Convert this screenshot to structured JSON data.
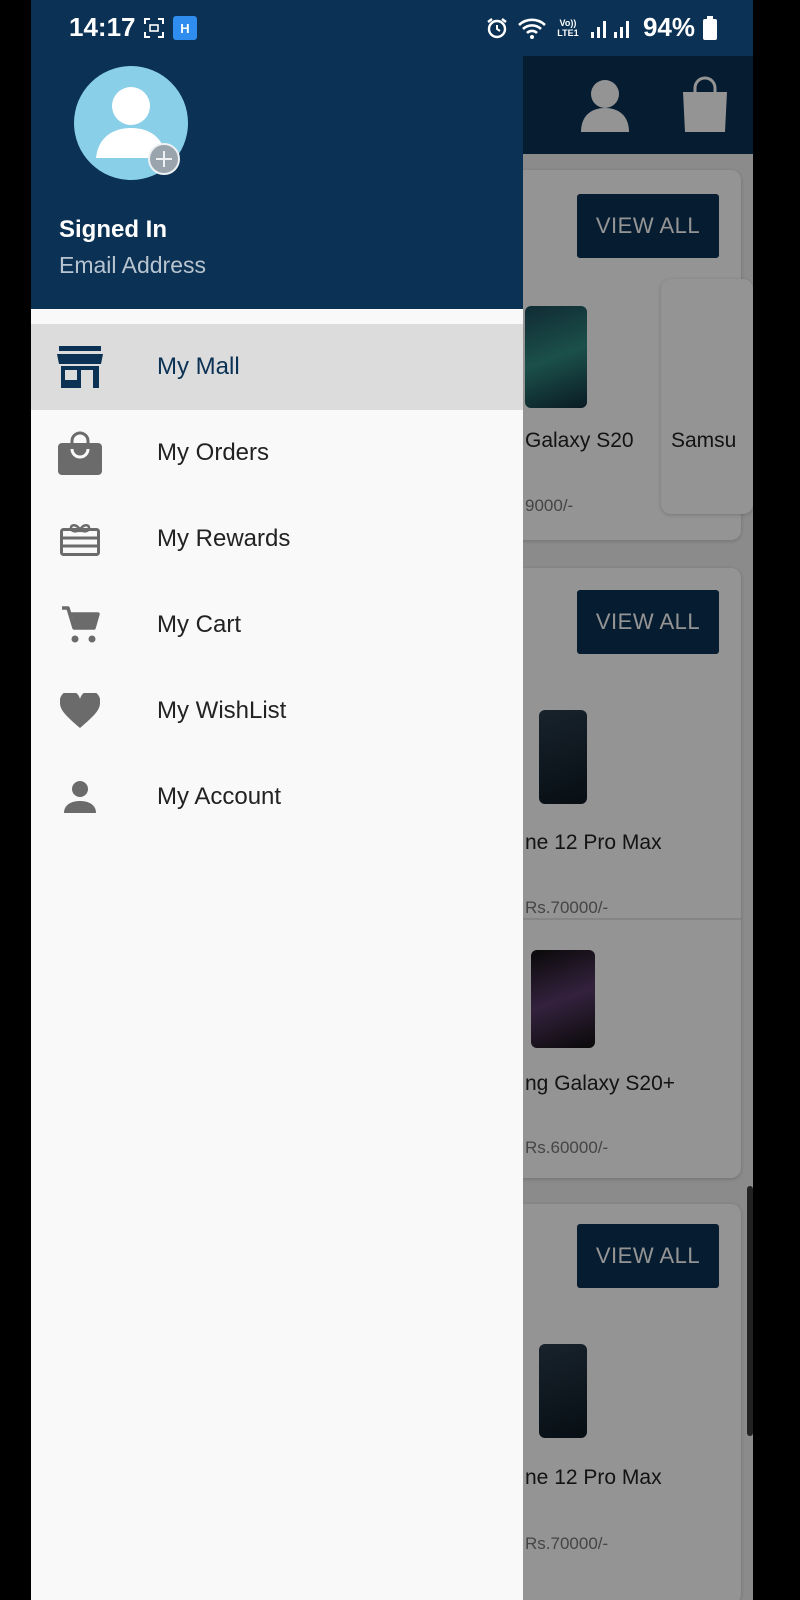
{
  "status_bar": {
    "time": "14:17",
    "battery": "94%",
    "icons": [
      "screenshot-icon",
      "app-h-icon",
      "alarm-icon",
      "wifi-icon",
      "volte-icon",
      "signal-icon",
      "battery-icon"
    ],
    "app_badge": "H",
    "volte_label": "Vo)) LTE1"
  },
  "appbar": {
    "icons": [
      "account-icon",
      "shopping-bag-icon"
    ]
  },
  "background": {
    "sections": [
      {
        "view_all": "VIEW ALL",
        "products": [
          {
            "name": "Galaxy S20",
            "price": "9000/-"
          },
          {
            "name": "Samsu",
            "price": ""
          }
        ]
      },
      {
        "view_all": "VIEW ALL",
        "products": [
          {
            "name": "ne 12 Pro Max",
            "price": "Rs.70000/-"
          },
          {
            "name": "ng Galaxy S20+",
            "price": "Rs.60000/-"
          }
        ]
      },
      {
        "view_all": "VIEW ALL",
        "products": [
          {
            "name": "ne 12 Pro Max",
            "price": "Rs.70000/-"
          }
        ]
      }
    ]
  },
  "drawer": {
    "header": {
      "signed_in": "Signed In",
      "email": "Email Address"
    },
    "menu": [
      {
        "label": "My Mall",
        "icon": "store-icon",
        "active": true
      },
      {
        "label": "My Orders",
        "icon": "shopping-bag-icon",
        "active": false
      },
      {
        "label": "My Rewards",
        "icon": "gift-card-icon",
        "active": false
      },
      {
        "label": "My Cart",
        "icon": "cart-icon",
        "active": false
      },
      {
        "label": "My WishList",
        "icon": "heart-icon",
        "active": false
      },
      {
        "label": "My Account",
        "icon": "person-icon",
        "active": false
      }
    ],
    "colors": {
      "header_bg": "#0b3154",
      "active_item_bg": "#dcdcdc",
      "icon_gray": "#6b6b6b"
    }
  }
}
